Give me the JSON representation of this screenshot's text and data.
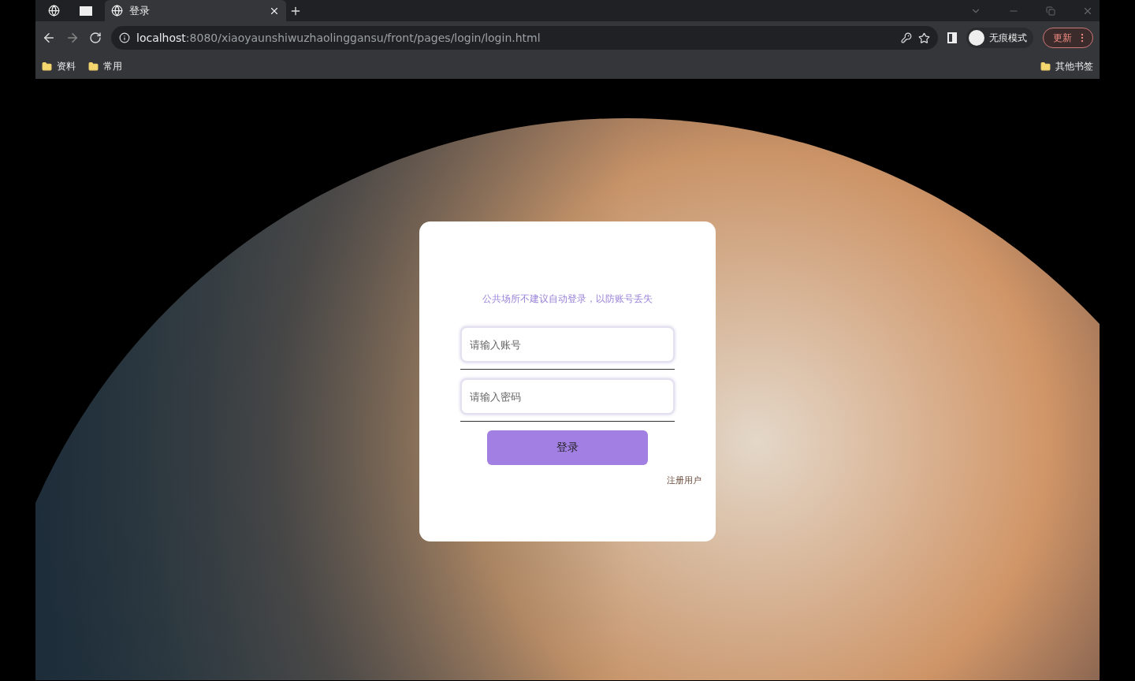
{
  "browser": {
    "tabs": [
      {
        "kind": "pinned",
        "selected": false
      },
      {
        "kind": "pinned",
        "selected": false
      },
      {
        "kind": "page",
        "label": "登录",
        "selected": true
      }
    ],
    "address": {
      "host": "localhost",
      "rest": ":8080/xiaoyaunshiwuzhaolinggansu/front/pages/login/login.html"
    },
    "profile": "无痕模式",
    "update_button": "更新",
    "bookmarks": [
      "资料",
      "常用"
    ],
    "other_bookmarks": "其他书签"
  },
  "login": {
    "notice": "公共场所不建议自动登录，以防账号丢失",
    "fields": [
      {
        "placeholder": "请输入账号"
      },
      {
        "placeholder": "请输入密码"
      }
    ],
    "submit": "登录",
    "register_link": "注册用户"
  }
}
